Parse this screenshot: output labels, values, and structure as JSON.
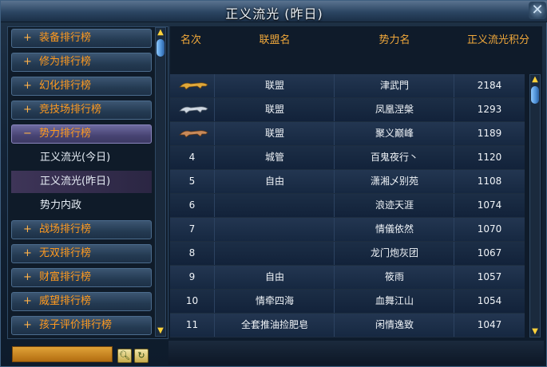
{
  "window": {
    "title": "正义流光 (昨日)"
  },
  "sidebar": {
    "categories_top": [
      {
        "sign": "+",
        "label": "装备排行榜"
      },
      {
        "sign": "+",
        "label": "修为排行榜"
      },
      {
        "sign": "+",
        "label": "幻化排行榜"
      },
      {
        "sign": "+",
        "label": "竞技场排行榜"
      },
      {
        "sign": "−",
        "label": "势力排行榜"
      }
    ],
    "subitems": [
      {
        "label": "正义流光(今日)"
      },
      {
        "label": "正义流光(昨日)"
      },
      {
        "label": "势力内政"
      }
    ],
    "categories_bottom": [
      {
        "sign": "+",
        "label": "战场排行榜"
      },
      {
        "sign": "+",
        "label": "无双排行榜"
      },
      {
        "sign": "+",
        "label": "财富排行榜"
      },
      {
        "sign": "+",
        "label": "威望排行榜"
      },
      {
        "sign": "+",
        "label": "孩子评价排行榜"
      }
    ]
  },
  "table": {
    "headers": {
      "rank": "名次",
      "alliance": "联盟名",
      "faction": "势力名",
      "score": "正义流光积分"
    },
    "rows": [
      {
        "rank": "",
        "rank_icon": "gold-tiger-icon",
        "alliance": "联盟",
        "faction": "津武門",
        "score": "2184"
      },
      {
        "rank": "",
        "rank_icon": "silver-tiger-icon",
        "alliance": "联盟",
        "faction": "凤凰涅槃",
        "score": "1293"
      },
      {
        "rank": "",
        "rank_icon": "bronze-tiger-icon",
        "alliance": "联盟",
        "faction": "聚义巅峰",
        "score": "1189"
      },
      {
        "rank": "4",
        "alliance": "城管",
        "faction": "百鬼夜行丶",
        "score": "1120"
      },
      {
        "rank": "5",
        "alliance": "自由",
        "faction": "潇湘乄别苑",
        "score": "1108"
      },
      {
        "rank": "6",
        "alliance": "",
        "faction": "浪迹天涯",
        "score": "1074"
      },
      {
        "rank": "7",
        "alliance": "",
        "faction": "情儀依然",
        "score": "1070"
      },
      {
        "rank": "8",
        "alliance": "",
        "faction": "龙门炮灰团",
        "score": "1067"
      },
      {
        "rank": "9",
        "alliance": "自由",
        "faction": "筱雨",
        "score": "1057"
      },
      {
        "rank": "10",
        "alliance": "情牵四海",
        "faction": "血舞江山",
        "score": "1054"
      },
      {
        "rank": "11",
        "alliance": "全套推油捡肥皂",
        "faction": "闲情逸致",
        "score": "1047"
      }
    ]
  },
  "colors": {
    "accent": "#ff9a1f",
    "header": "#f2a93b",
    "text": "#f0f4f8",
    "selected_sub": "#3e3558",
    "scroll_thumb": "#4c8fd6"
  }
}
